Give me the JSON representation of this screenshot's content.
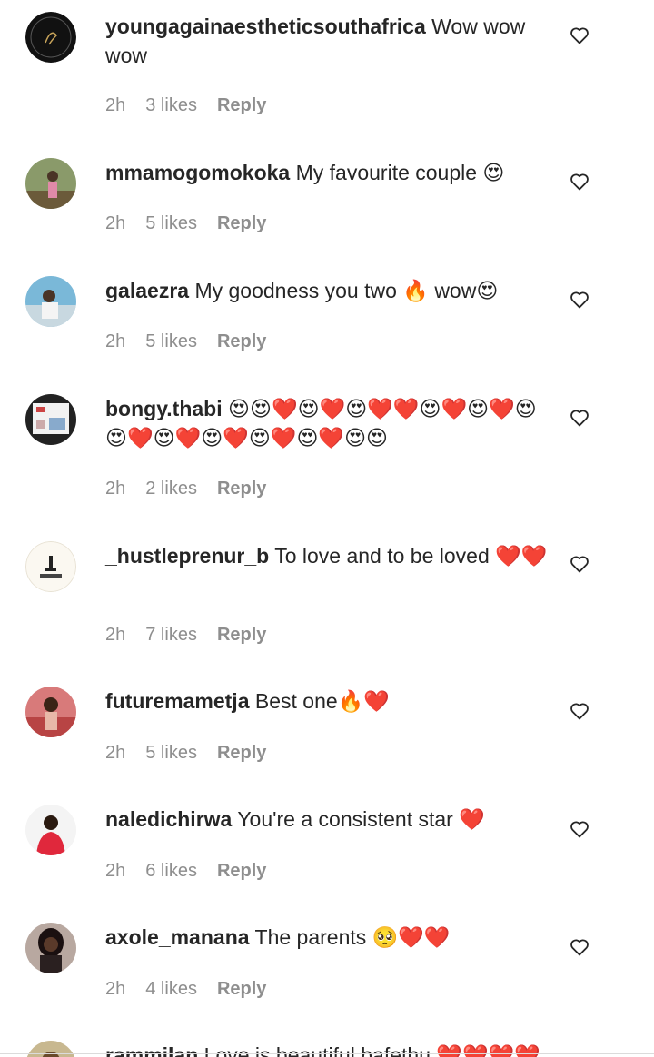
{
  "comments": [
    {
      "user": "youngagainaestheticsouthafrica",
      "text": "Wow wow wow",
      "time": "2h",
      "likes": "3 likes",
      "reply": "Reply"
    },
    {
      "user": "mmamogomokoka",
      "text": "My favourite couple 😍",
      "time": "2h",
      "likes": "5 likes",
      "reply": "Reply"
    },
    {
      "user": "galaezra",
      "text": "My goodness you two 🔥 wow😍",
      "time": "2h",
      "likes": "5 likes",
      "reply": "Reply"
    },
    {
      "user": "bongy.thabi",
      "text": "😍😍❤️😍❤️😍❤️❤️😍❤️😍❤️😍😍❤️😍❤️😍❤️😍❤️😍❤️😍😍",
      "time": "2h",
      "likes": "2 likes",
      "reply": "Reply"
    },
    {
      "user": "_hustleprenur_b",
      "text": "To love and to be loved ❤️❤️",
      "time": "2h",
      "likes": "7 likes",
      "reply": "Reply"
    },
    {
      "user": "futuremametja",
      "text": "Best one🔥❤️",
      "time": "2h",
      "likes": "5 likes",
      "reply": "Reply"
    },
    {
      "user": "naledichirwa",
      "text": "You're a consistent star ❤️",
      "time": "2h",
      "likes": "6 likes",
      "reply": "Reply"
    },
    {
      "user": "axole_manana",
      "text": "The parents 🥺❤️❤️",
      "time": "2h",
      "likes": "4 likes",
      "reply": "Reply"
    },
    {
      "user": "rammilan",
      "text": "Love is beautiful bafethu ❤️❤️❤️❤️",
      "time": "",
      "likes": "",
      "reply": ""
    }
  ],
  "icons": {
    "like": "heart-outline-icon"
  },
  "colors": {
    "text": "#262626",
    "muted": "#8e8e8e",
    "background": "#ffffff"
  }
}
